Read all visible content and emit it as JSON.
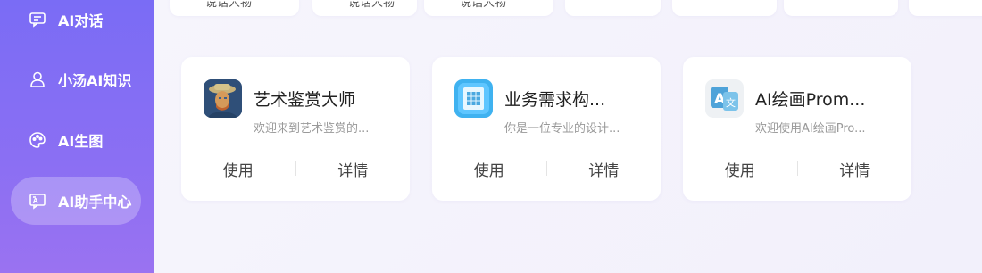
{
  "sidebar": {
    "items": [
      {
        "label": "AI对话",
        "icon": "chat-icon"
      },
      {
        "label": "小汤AI知识",
        "icon": "user-icon"
      },
      {
        "label": "AI生图",
        "icon": "palette-icon"
      },
      {
        "label": "AI助手中心",
        "icon": "assistant-icon",
        "active": true
      }
    ]
  },
  "top_cards": [
    {
      "text": "说话人物"
    },
    {
      "text": "说话人物"
    },
    {
      "text": "说话人物"
    }
  ],
  "cards": [
    {
      "title": "艺术鉴赏大师",
      "description": "欢迎来到艺术鉴赏的...",
      "use_label": "使用",
      "detail_label": "详情",
      "logo": "art-portrait-logo"
    },
    {
      "title": "业务需求构...",
      "description": "你是一位专业的设计...",
      "use_label": "使用",
      "detail_label": "详情",
      "logo": "blueprint-logo"
    },
    {
      "title": "AI绘画Prom...",
      "description": "欢迎使用AI绘画Pro...",
      "use_label": "使用",
      "detail_label": "详情",
      "logo": "translate-logo"
    }
  ],
  "colors": {
    "sidebar_start": "#7a6cf5",
    "sidebar_end": "#9a72f1",
    "active_item_bg": "rgba(255,255,255,0.25)",
    "card_bg": "#ffffff"
  }
}
